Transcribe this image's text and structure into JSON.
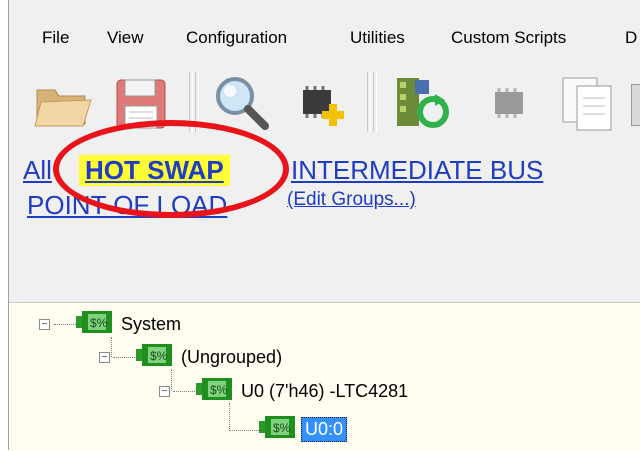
{
  "menubar": {
    "items": [
      "File",
      "View",
      "Configuration",
      "Utilities",
      "Custom Scripts",
      "D"
    ]
  },
  "toolbar": {
    "buttons": [
      "open-folder-icon",
      "save-disk-icon",
      "search-magnifier-icon",
      "add-chip-icon",
      "scan-refresh-icon",
      "chip-disabled-icon",
      "copy-document-icon"
    ]
  },
  "groups": {
    "all": "All",
    "hot_swap": "HOT SWAP",
    "intermediate_bus": "INTERMEDIATE BUS",
    "point_of_load": "POINT OF LOAD",
    "edit_groups": "(Edit Groups...)"
  },
  "tree": {
    "nodes": [
      {
        "label": "System",
        "expander": "−"
      },
      {
        "label": "(Ungrouped)",
        "expander": "−"
      },
      {
        "label": "U0 (7'h46) -LTC4281",
        "expander": "−"
      },
      {
        "label": "U0:0"
      }
    ]
  },
  "colors": {
    "link": "#1f3cc6",
    "highlight": "#ffff33",
    "annotation": "#e8141a",
    "tree_bg": "#fffef0",
    "selection": "#3390ff"
  }
}
